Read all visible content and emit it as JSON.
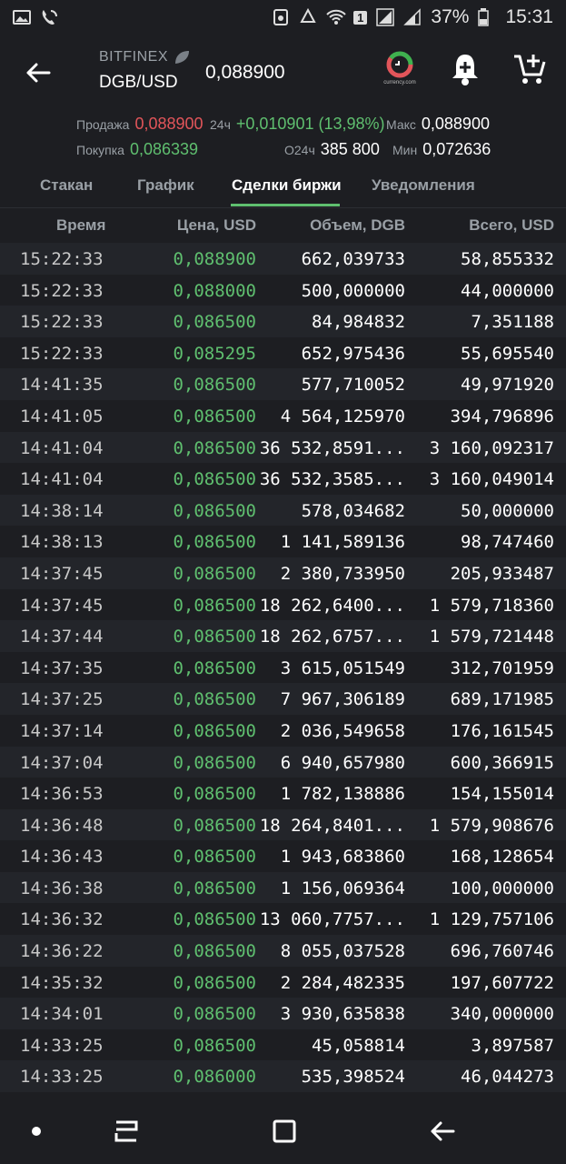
{
  "status_bar": {
    "battery": "37%",
    "sim_slot": "1",
    "time": "15:31"
  },
  "header": {
    "exchange": "BITFINEX",
    "pair": "DGB/USD",
    "price": "0,088900",
    "logo_caption": "currency.com"
  },
  "stats": {
    "sell_label": "Продажа",
    "sell_value": "0,088900",
    "buy_label": "Покупка",
    "buy_value": "0,086339",
    "change_label": "24ч",
    "change_value": "+0,010901 (13,98%)",
    "volume_label": "O24ч",
    "volume_value": "385 800",
    "max_label": "Макс",
    "max_value": "0,088900",
    "min_label": "Мин",
    "min_value": "0,072636"
  },
  "tabs": [
    {
      "label": "Стакан"
    },
    {
      "label": "График"
    },
    {
      "label": "Сделки биржи"
    },
    {
      "label": "Уведомления"
    }
  ],
  "table": {
    "headers": [
      "Время",
      "Цена, USD",
      "Объем, DGB",
      "Всего, USD"
    ],
    "rows": [
      {
        "time": "15:22:33",
        "price": "0,088900",
        "volume": "662,039733",
        "total": "58,855332"
      },
      {
        "time": "15:22:33",
        "price": "0,088000",
        "volume": "500,000000",
        "total": "44,000000"
      },
      {
        "time": "15:22:33",
        "price": "0,086500",
        "volume": "84,984832",
        "total": "7,351188"
      },
      {
        "time": "15:22:33",
        "price": "0,085295",
        "volume": "652,975436",
        "total": "55,695540"
      },
      {
        "time": "14:41:35",
        "price": "0,086500",
        "volume": "577,710052",
        "total": "49,971920"
      },
      {
        "time": "14:41:05",
        "price": "0,086500",
        "volume": "4 564,125970",
        "total": "394,796896"
      },
      {
        "time": "14:41:04",
        "price": "0,086500",
        "volume": "36 532,8591...",
        "total": "3 160,092317"
      },
      {
        "time": "14:41:04",
        "price": "0,086500",
        "volume": "36 532,3585...",
        "total": "3 160,049014"
      },
      {
        "time": "14:38:14",
        "price": "0,086500",
        "volume": "578,034682",
        "total": "50,000000"
      },
      {
        "time": "14:38:13",
        "price": "0,086500",
        "volume": "1 141,589136",
        "total": "98,747460"
      },
      {
        "time": "14:37:45",
        "price": "0,086500",
        "volume": "2 380,733950",
        "total": "205,933487"
      },
      {
        "time": "14:37:45",
        "price": "0,086500",
        "volume": "18 262,6400...",
        "total": "1 579,718360"
      },
      {
        "time": "14:37:44",
        "price": "0,086500",
        "volume": "18 262,6757...",
        "total": "1 579,721448"
      },
      {
        "time": "14:37:35",
        "price": "0,086500",
        "volume": "3 615,051549",
        "total": "312,701959"
      },
      {
        "time": "14:37:25",
        "price": "0,086500",
        "volume": "7 967,306189",
        "total": "689,171985"
      },
      {
        "time": "14:37:14",
        "price": "0,086500",
        "volume": "2 036,549658",
        "total": "176,161545"
      },
      {
        "time": "14:37:04",
        "price": "0,086500",
        "volume": "6 940,657980",
        "total": "600,366915"
      },
      {
        "time": "14:36:53",
        "price": "0,086500",
        "volume": "1 782,138886",
        "total": "154,155014"
      },
      {
        "time": "14:36:48",
        "price": "0,086500",
        "volume": "18 264,8401...",
        "total": "1 579,908676"
      },
      {
        "time": "14:36:43",
        "price": "0,086500",
        "volume": "1 943,683860",
        "total": "168,128654"
      },
      {
        "time": "14:36:38",
        "price": "0,086500",
        "volume": "1 156,069364",
        "total": "100,000000"
      },
      {
        "time": "14:36:32",
        "price": "0,086500",
        "volume": "13 060,7757...",
        "total": "1 129,757106"
      },
      {
        "time": "14:36:22",
        "price": "0,086500",
        "volume": "8 055,037528",
        "total": "696,760746"
      },
      {
        "time": "14:35:32",
        "price": "0,086500",
        "volume": "2 284,482335",
        "total": "197,607722"
      },
      {
        "time": "14:34:01",
        "price": "0,086500",
        "volume": "3 930,635838",
        "total": "340,000000"
      },
      {
        "time": "14:33:25",
        "price": "0,086500",
        "volume": "45,058814",
        "total": "3,897587"
      },
      {
        "time": "14:33:25",
        "price": "0,086000",
        "volume": "535,398524",
        "total": "46,044273"
      }
    ]
  },
  "colors": {
    "background": "#1d1e22",
    "row_alt": "#23252a",
    "positive": "#5fbf6f",
    "negative": "#e2555a"
  },
  "icons": [
    "image-icon",
    "wifi-call-icon",
    "recycle-icon",
    "wifi-icon",
    "signal-icon",
    "battery-icon",
    "back-arrow-icon",
    "bell-add-icon",
    "cart-add-icon",
    "home-dot-icon",
    "recent-apps-icon",
    "overview-icon",
    "nav-back-icon"
  ]
}
